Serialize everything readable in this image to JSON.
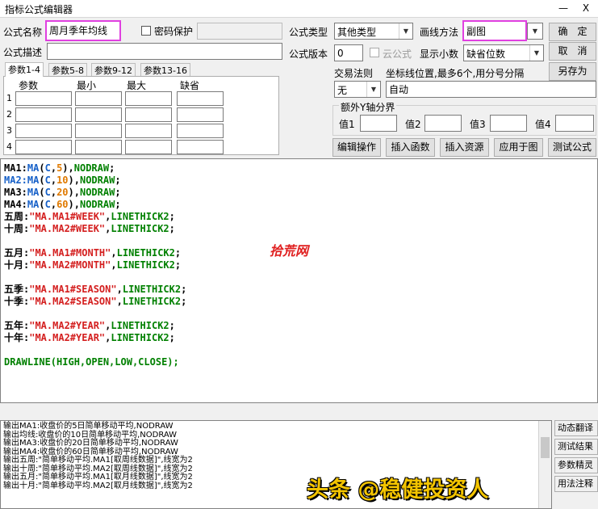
{
  "window": {
    "title": "指标公式编辑器",
    "min_glyph": "—",
    "close_glyph": "X"
  },
  "formula": {
    "name_label": "公式名称",
    "name_value": "周月季年均线",
    "password_label": "密码保护",
    "desc_label": "公式描述",
    "desc_value": "",
    "type_label": "公式类型",
    "type_value": "其他类型",
    "draw_label": "画线方法",
    "draw_value": "副图",
    "version_label": "公式版本",
    "version_value": "0",
    "cloud_label": "云公式",
    "decimals_label": "显示小数",
    "decimals_value": "缺省位数",
    "trade_rule_label": "交易法则",
    "trade_rule_value": "无",
    "coord_label": "坐标线位置,最多6个,用分号分隔",
    "coord_value": "自动",
    "yaxis_label": "额外Y轴分界",
    "yaxis_values": [
      "值1",
      "值2",
      "值3",
      "值4"
    ]
  },
  "buttons": {
    "ok": "确　定",
    "cancel": "取　消",
    "save_as": "另存为",
    "edit_ops": "编辑操作",
    "insert_func": "插入函数",
    "insert_res": "插入资源",
    "apply_chart": "应用于图",
    "test_formula": "测试公式"
  },
  "tabs": [
    "参数1-4",
    "参数5-8",
    "参数9-12",
    "参数13-16"
  ],
  "param_headers": [
    "参数",
    "最小",
    "最大",
    "缺省"
  ],
  "param_rows": [
    "1",
    "2",
    "3",
    "4"
  ],
  "code": [
    [
      [
        "MA1:",
        "blk"
      ],
      [
        "MA",
        "blue"
      ],
      [
        "(",
        "blk"
      ],
      [
        "C",
        "blue"
      ],
      [
        ",",
        "blk"
      ],
      [
        "5",
        "org"
      ],
      [
        "),",
        "blk"
      ],
      [
        "NODRAW",
        "grn"
      ],
      [
        ";",
        "blk"
      ]
    ],
    [
      [
        "MA2:",
        "blue"
      ],
      [
        "MA",
        "blue"
      ],
      [
        "(",
        "blk"
      ],
      [
        "C",
        "blue"
      ],
      [
        ",",
        "blk"
      ],
      [
        "10",
        "org"
      ],
      [
        "),",
        "blk"
      ],
      [
        "NODRAW",
        "grn"
      ],
      [
        ";",
        "blk"
      ]
    ],
    [
      [
        "MA3:",
        "blk"
      ],
      [
        "MA",
        "blue"
      ],
      [
        "(",
        "blk"
      ],
      [
        "C",
        "blue"
      ],
      [
        ",",
        "blk"
      ],
      [
        "20",
        "org"
      ],
      [
        "),",
        "blk"
      ],
      [
        "NODRAW",
        "grn"
      ],
      [
        ";",
        "blk"
      ]
    ],
    [
      [
        "MA4:",
        "blk"
      ],
      [
        "MA",
        "blue"
      ],
      [
        "(",
        "blk"
      ],
      [
        "C",
        "blue"
      ],
      [
        ",",
        "blk"
      ],
      [
        "60",
        "org"
      ],
      [
        "),",
        "blk"
      ],
      [
        "NODRAW",
        "grn"
      ],
      [
        ";",
        "blk"
      ]
    ],
    [
      [
        "五周:",
        "blk"
      ],
      [
        "\"MA.MA1#WEEK\"",
        "red"
      ],
      [
        ",",
        "blk"
      ],
      [
        "LINETHICK2",
        "grn"
      ],
      [
        ";",
        "blk"
      ]
    ],
    [
      [
        "十周:",
        "blk"
      ],
      [
        "\"MA.MA2#WEEK\"",
        "red"
      ],
      [
        ",",
        "blk"
      ],
      [
        "LINETHICK2",
        "grn"
      ],
      [
        ";",
        "blk"
      ]
    ],
    [],
    [
      [
        "五月:",
        "blk"
      ],
      [
        "\"MA.MA1#MONTH\"",
        "red"
      ],
      [
        ",",
        "blk"
      ],
      [
        "LINETHICK2",
        "grn"
      ],
      [
        ";",
        "blk"
      ]
    ],
    [
      [
        "十月:",
        "blk"
      ],
      [
        "\"MA.MA2#MONTH\"",
        "red"
      ],
      [
        ",",
        "blk"
      ],
      [
        "LINETHICK2",
        "grn"
      ],
      [
        ";",
        "blk"
      ]
    ],
    [],
    [
      [
        "五季:",
        "blk"
      ],
      [
        "\"MA.MA1#SEASON\"",
        "red"
      ],
      [
        ",",
        "blk"
      ],
      [
        "LINETHICK2",
        "grn"
      ],
      [
        ";",
        "blk"
      ]
    ],
    [
      [
        "十季:",
        "blk"
      ],
      [
        "\"MA.MA2#SEASON\"",
        "red"
      ],
      [
        ",",
        "blk"
      ],
      [
        "LINETHICK2",
        "grn"
      ],
      [
        ";",
        "blk"
      ]
    ],
    [],
    [
      [
        "五年:",
        "blk"
      ],
      [
        "\"MA.MA2#YEAR\"",
        "red"
      ],
      [
        ",",
        "blk"
      ],
      [
        "LINETHICK2",
        "grn"
      ],
      [
        ";",
        "blk"
      ]
    ],
    [
      [
        "十年:",
        "blk"
      ],
      [
        "\"MA.MA2#YEAR\"",
        "red"
      ],
      [
        ",",
        "blk"
      ],
      [
        "LINETHICK2",
        "grn"
      ],
      [
        ";",
        "blk"
      ]
    ],
    [],
    [
      [
        "DRAWLINE(HIGH,OPEN,LOW,CLOSE);",
        "grn"
      ]
    ]
  ],
  "watermark": "拾荒网",
  "output_lines": [
    "输出MA1:收盘价的5日简单移动平均,NODRAW",
    "输出均线:收盘价的10日简单移动平均,NODRAW",
    "输出MA3:收盘价的20日简单移动平均,NODRAW",
    "输出MA4:收盘价的60日简单移动平均,NODRAW",
    "输出五周:\"简单移动平均.MA1[取周线数据]\",线宽为2",
    "输出十周:\"简单移动平均.MA2[取周线数据]\",线宽为2",
    "输出五月:\"简单移动平均.MA1[取月线数据]\",线宽为2",
    "输出十月:\"简单移动平均.MA2[取月线数据]\",线宽为2"
  ],
  "side_buttons": [
    "动态翻译",
    "测试结果",
    "参数精灵",
    "用法注释"
  ],
  "banner": "头条 @稳健投资人",
  "colors": {
    "highlight": "#e040e0",
    "string": "#d41f1f",
    "keyword": "#008000",
    "func": "#1660c8",
    "number": "#e07a00"
  }
}
